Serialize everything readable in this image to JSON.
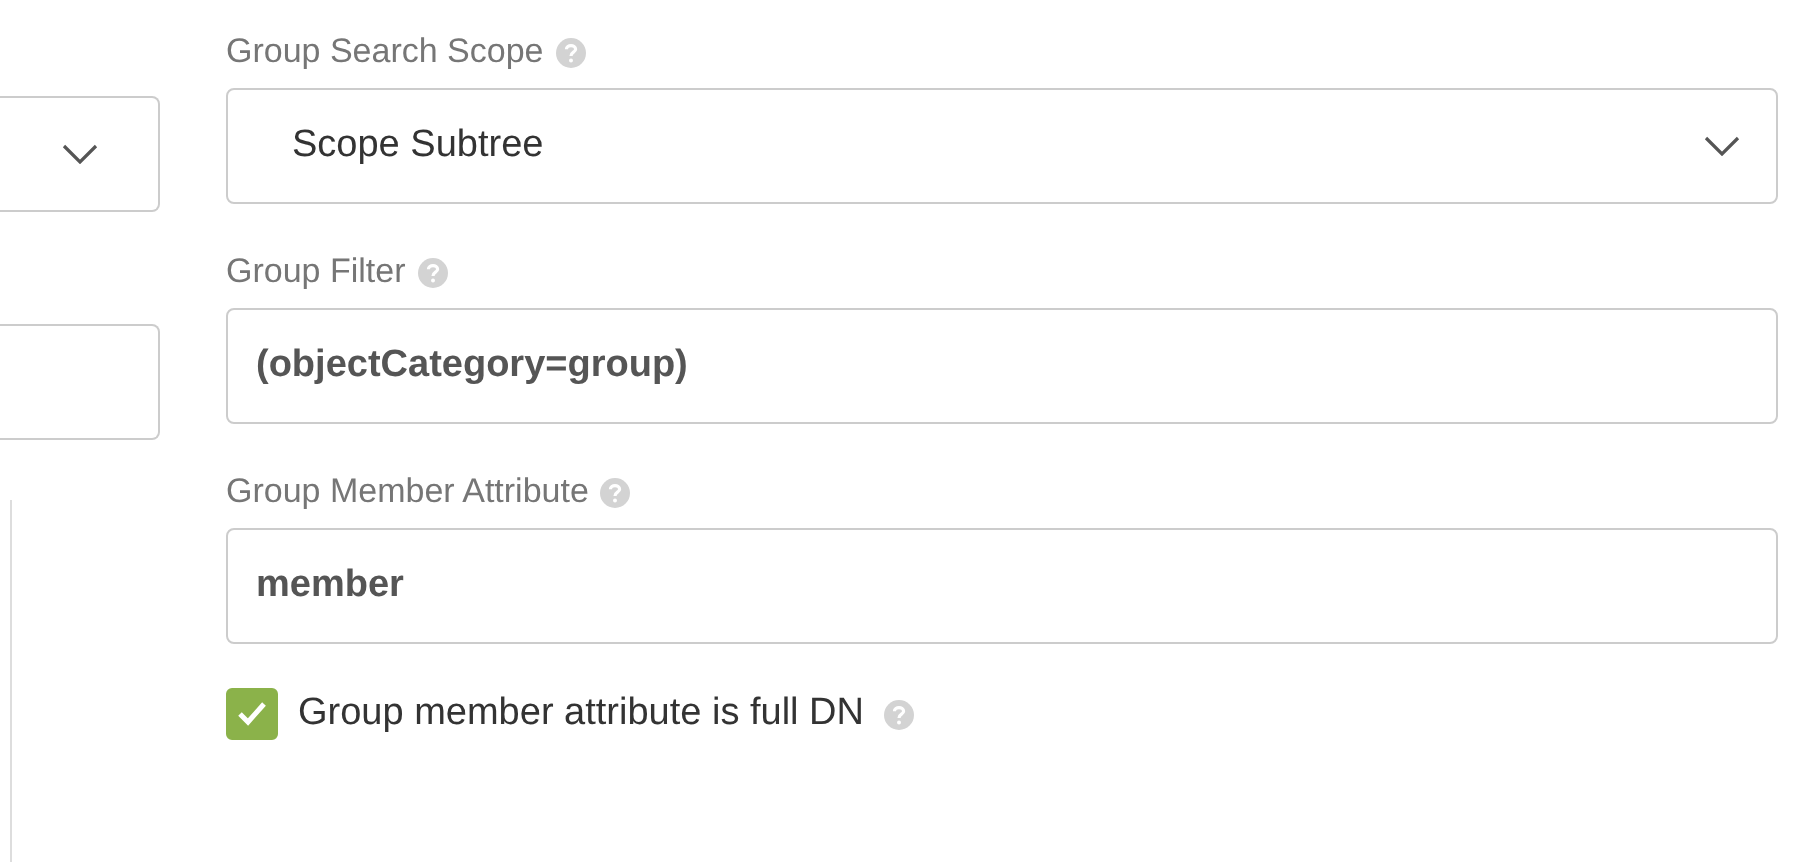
{
  "left_fields": [
    {
      "kind": "select"
    },
    {
      "kind": "input"
    }
  ],
  "fields": [
    {
      "kind": "select",
      "label": "Group Search Scope",
      "value": "Scope Subtree"
    },
    {
      "kind": "input",
      "label": "Group Filter",
      "value": "(objectCategory=group)"
    },
    {
      "kind": "input",
      "label": "Group Member Attribute",
      "value": "member"
    }
  ],
  "checkbox": {
    "label": "Group member attribute is full DN",
    "checked": true
  }
}
